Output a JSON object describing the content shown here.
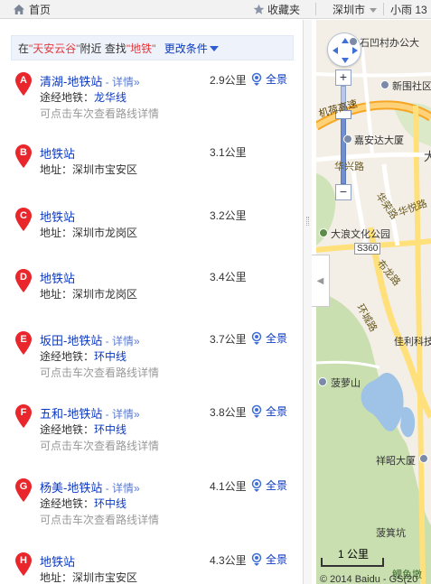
{
  "topbar": {
    "home_label": "首页",
    "favorites_label": "收藏夹",
    "city_label": "深圳市",
    "weather_label": "小雨 13"
  },
  "query": {
    "prefix": "在",
    "place": "\"天安云谷\"",
    "middle": "附近 查找",
    "keyword": "\"地铁\"",
    "change_label": "更改条件"
  },
  "results": [
    {
      "letter": "A",
      "name": "清湖-地铁站",
      "detail": " - 详情»",
      "distance": "2.9公里",
      "pano": "全景",
      "label2": "途经地铁：",
      "value2": "龙华线",
      "hint": "可点击车次查看路线详情"
    },
    {
      "letter": "B",
      "name": "地铁站",
      "detail": "",
      "distance": "3.1公里",
      "pano": "",
      "label2": "地址：",
      "value2": "深圳市宝安区",
      "hint": ""
    },
    {
      "letter": "C",
      "name": "地铁站",
      "detail": "",
      "distance": "3.2公里",
      "pano": "",
      "label2": "地址：",
      "value2": "深圳市龙岗区",
      "hint": ""
    },
    {
      "letter": "D",
      "name": "地铁站",
      "detail": "",
      "distance": "3.4公里",
      "pano": "",
      "label2": "地址：",
      "value2": "深圳市龙岗区",
      "hint": ""
    },
    {
      "letter": "E",
      "name": "坂田-地铁站",
      "detail": " - 详情»",
      "distance": "3.7公里",
      "pano": "全景",
      "label2": "途经地铁：",
      "value2": "环中线",
      "hint": "可点击车次查看路线详情"
    },
    {
      "letter": "F",
      "name": "五和-地铁站",
      "detail": " - 详情»",
      "distance": "3.8公里",
      "pano": "全景",
      "label2": "途经地铁：",
      "value2": "环中线",
      "hint": "可点击车次查看路线详情"
    },
    {
      "letter": "G",
      "name": "杨美-地铁站",
      "detail": " - 详情»",
      "distance": "4.1公里",
      "pano": "全景",
      "label2": "途经地铁：",
      "value2": "环中线",
      "hint": "可点击车次查看路线详情"
    },
    {
      "letter": "H",
      "name": "地铁站",
      "detail": "",
      "distance": "4.3公里",
      "pano": "全景",
      "label2": "地址：",
      "value2": "深圳市宝安区",
      "hint": ""
    }
  ],
  "map": {
    "labels": [
      "石凹村办公大",
      "新围社区",
      "机荷高速",
      "嘉安达大厦",
      "华兴路",
      "华荣路",
      "华悦路",
      "大浪文化公园",
      "S360",
      "布龙路",
      "环城路",
      "佳利科技",
      "菠萝山",
      "祥昭大厦",
      "菠箕坑",
      "鲤鱼墩",
      "大"
    ],
    "scale_label": "1 公里",
    "copyright": "© 2014 Baidu - GS(20"
  },
  "colors": {
    "link": "#0b39c3",
    "highlight": "#e4393c",
    "marker": "#e8262c",
    "highway": "#f5a623"
  }
}
